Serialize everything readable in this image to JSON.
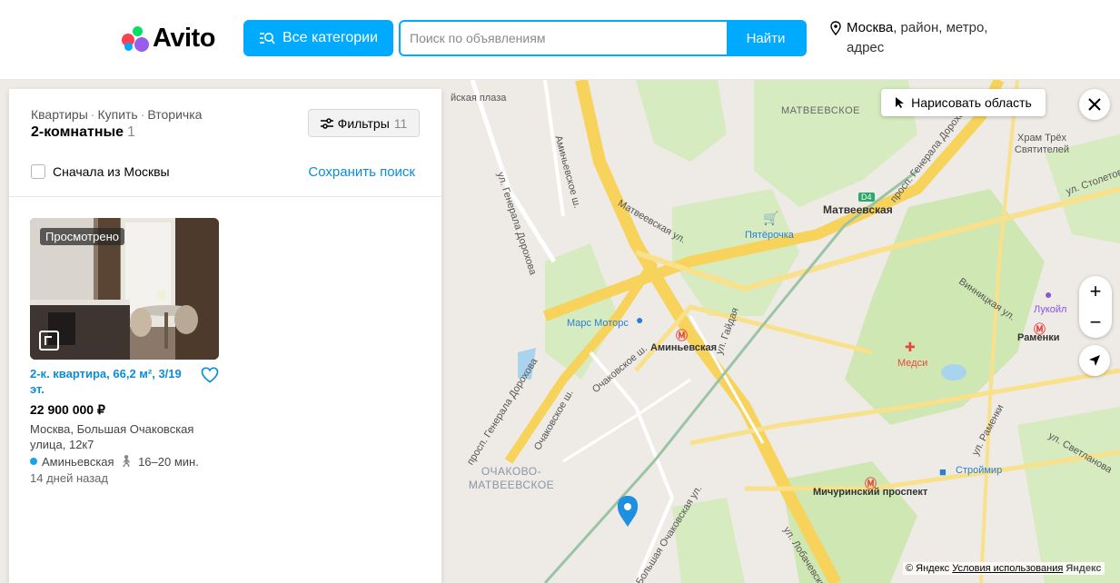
{
  "header": {
    "logo_text": "Avito",
    "categories_label": "Все категории",
    "search_placeholder": "Поиск по объявлениям",
    "search_button": "Найти",
    "location_city": "Москва",
    "location_rest": ", район, метро, адрес"
  },
  "panel": {
    "breadcrumbs": [
      "Квартиры",
      "Купить",
      "Вторичка"
    ],
    "title": "2-комнатные",
    "count": "1",
    "filters_label": "Фильтры",
    "filters_count": "11",
    "checkbox_label": "Сначала из Москвы",
    "save_search": "Сохранить поиск"
  },
  "listing": {
    "badge": "Просмотрено",
    "title": "2-к. квартира, 66,2 м², 3/19 эт.",
    "price": "22 900 000 ₽",
    "address": "Москва, Большая Очаковская улица, 12к7",
    "metro": "Аминьевская",
    "walk": "16–20 мин.",
    "posted": "14 дней назад"
  },
  "map": {
    "draw_area": "Нарисовать область",
    "labels": {
      "plaza": "йская плаза",
      "matveevskoe": "МАТВЕЕВСКОЕ",
      "hram": "Храм Трёх Святителей",
      "matveevskaya_station": "Матвеевская",
      "pyaterochka": "Пятёрочка",
      "lukoil": "Лукойл",
      "ramenki": "Раменки",
      "mars_motors": "Марс Моторс",
      "aminevskaya": "Аминьевская",
      "medsi": "Медси",
      "ochakovo": "ОЧАКОВО- МАТВЕЕВСКОЕ",
      "stroimir": "Строймир",
      "michurinsky": "Мичуринский проспект",
      "aminevskoe_sh": "Аминьевское ш.",
      "matveevskaya_ul": "Матвеевская ул.",
      "gen_dorokhova": "ул. Генерала Дорохова",
      "prosp_dorokhova": "просп. Генерала Дорохова",
      "ochakovskoe_sh": "Очаковское ш.",
      "gaidaya": "ул. Гайдая",
      "vinnitskaya": "Винницкая ул.",
      "ul_rameni": "ул. Раменки",
      "svetlanova": "ул. Светланова",
      "stoletova": "ул. Столетова",
      "b_ochakovskaya": "Большая Очаковская ул.",
      "lobachevskogo": "ул. Лобачевского",
      "d4": "D4"
    },
    "copyright": "© Яндекс",
    "terms": "Условия использования",
    "yandex": "Яндекс"
  },
  "colors": {
    "accent": "#00aaff",
    "link": "#0a8ed6",
    "metro_red": "#e8453c",
    "road_yellow": "#f7d35c",
    "park_green": "#cfe8b3",
    "water": "#aad3ee"
  }
}
